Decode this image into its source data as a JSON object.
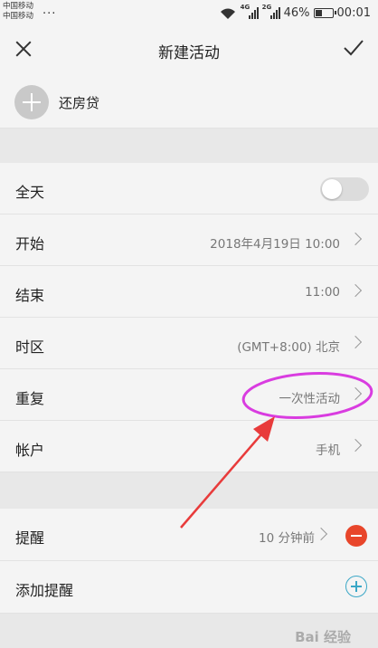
{
  "status_bar": {
    "carrier_1": "中国移动",
    "carrier_2": "中国移动",
    "more": "...",
    "sig_tag_1": "4G",
    "sig_tag_2": "2G",
    "battery_pct": "46%",
    "battery_level": 0.46,
    "time": "00:01"
  },
  "header": {
    "title": "新建活动",
    "close_icon": "close-icon",
    "confirm_icon": "check-icon"
  },
  "event": {
    "name": "还房贷",
    "icon": "plus-icon"
  },
  "rows": {
    "all_day": {
      "label": "全天",
      "toggle_on": false
    },
    "start": {
      "label": "开始",
      "value": "2018年4月19日 10:00"
    },
    "end": {
      "label": "结束",
      "value": "11:00"
    },
    "timezone": {
      "label": "时区",
      "value": "(GMT+8:00) 北京"
    },
    "repeat": {
      "label": "重复",
      "value": "一次性活动"
    },
    "account": {
      "label": "帐户",
      "value": "手机"
    }
  },
  "reminder": {
    "label": "提醒",
    "value": "10 分钟前",
    "remove_icon": "minus-circle-icon",
    "add_label": "添加提醒",
    "add_icon": "plus-circle-icon"
  },
  "annotation": {
    "highlight_color": "#d93ce0",
    "arrow_color": "#e83b3b"
  },
  "watermark": "Bai 经验"
}
